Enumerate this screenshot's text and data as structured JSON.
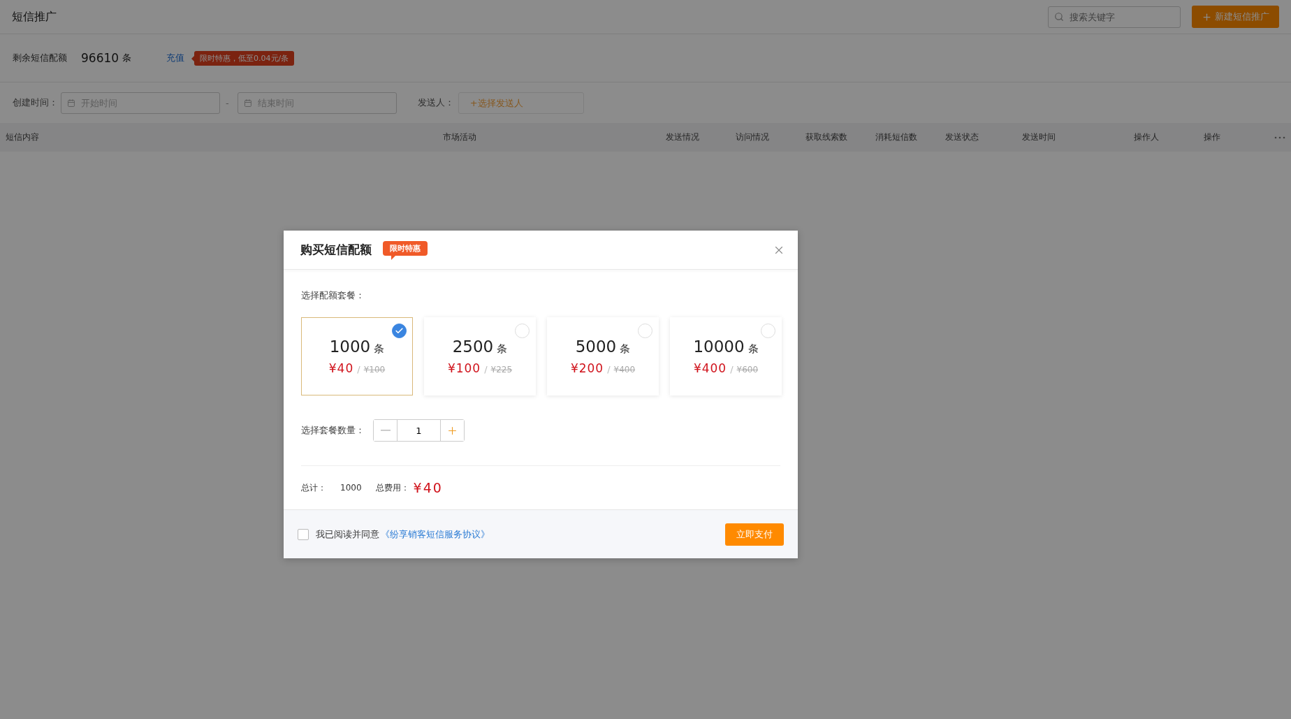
{
  "header": {
    "title": "短信推广",
    "search": {
      "placeholder": "搜索关键字"
    },
    "new_button": "新建短信推广"
  },
  "quota": {
    "label": "剩余短信配额",
    "value": "96610",
    "unit": "条",
    "recharge": "充值",
    "promo": "限时特惠，低至0.04元/条"
  },
  "filters": {
    "created_label": "创建时间：",
    "start": {
      "placeholder": "开始时间"
    },
    "separator": "-",
    "end": {
      "placeholder": "结束时间"
    },
    "sender_label": "发送人：",
    "sender": {
      "placeholder": "+选择发送人"
    }
  },
  "table": {
    "columns": [
      "短信内容",
      "市场活动",
      "发送情况",
      "访问情况",
      "获取线索数",
      "消耗短信数",
      "发送状态",
      "发送时间",
      "操作人",
      "操作"
    ]
  },
  "dialog": {
    "title": "购买短信配额",
    "badge": "限时特惠",
    "package_label": "选择配额套餐：",
    "packages": [
      {
        "count": "1000",
        "unit": "条",
        "price": "¥40",
        "separator": "/",
        "original": "¥100",
        "selected": true
      },
      {
        "count": "2500",
        "unit": "条",
        "price": "¥100",
        "separator": "/",
        "original": "¥225",
        "selected": false
      },
      {
        "count": "5000",
        "unit": "条",
        "price": "¥200",
        "separator": "/",
        "original": "¥400",
        "selected": false
      },
      {
        "count": "10000",
        "unit": "条",
        "price": "¥400",
        "separator": "/",
        "original": "¥600",
        "selected": false
      }
    ],
    "quantity_label": "选择套餐数量：",
    "quantity": "1",
    "total_label": "总计：",
    "total": "1000",
    "cost_label": "总费用：",
    "cost": "¥40",
    "agreement": {
      "checked": false,
      "text": "我已阅读并同意",
      "link": "《纷享销客短信服务协议》"
    },
    "pay_button": "立即支付"
  }
}
